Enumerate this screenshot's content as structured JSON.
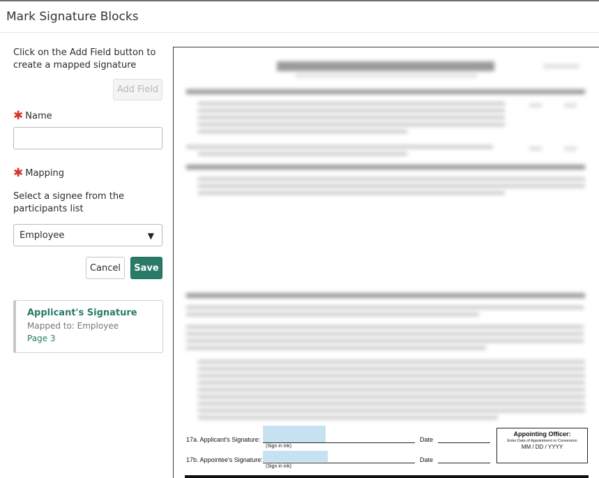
{
  "dialog": {
    "title": "Mark Signature Blocks"
  },
  "left_panel": {
    "instructions": "Click on the Add Field button to create a mapped signature",
    "add_field_label": "Add Field",
    "name_label": "Name",
    "name_value": "",
    "name_placeholder": "",
    "mapping_label": "Mapping",
    "mapping_helper": "Select a signee from the participants list",
    "mapping_selected": "Employee",
    "cancel_label": "Cancel",
    "save_label": "Save",
    "required_mark": "✱",
    "caret": "▼"
  },
  "signature_fields": [
    {
      "title": "Applicant's Signature",
      "mapped": "Mapped to: Employee",
      "page": "Page 3"
    }
  ],
  "document": {
    "applicant_sig_label": "17a. Applicant's Signature:",
    "appointee_sig_label": "17b. Appointee's Signature:",
    "sign_in_ink": "(Sign in ink)",
    "date_label": "Date",
    "officer_title": "Appointing Officer:",
    "officer_sub": "Enter Date of Appointment or Conversion",
    "officer_format": "MM / DD / YYYY"
  },
  "colors": {
    "accent": "#2a7a69",
    "required": "#d6312a",
    "signature_highlight": "#c6e2f2"
  }
}
